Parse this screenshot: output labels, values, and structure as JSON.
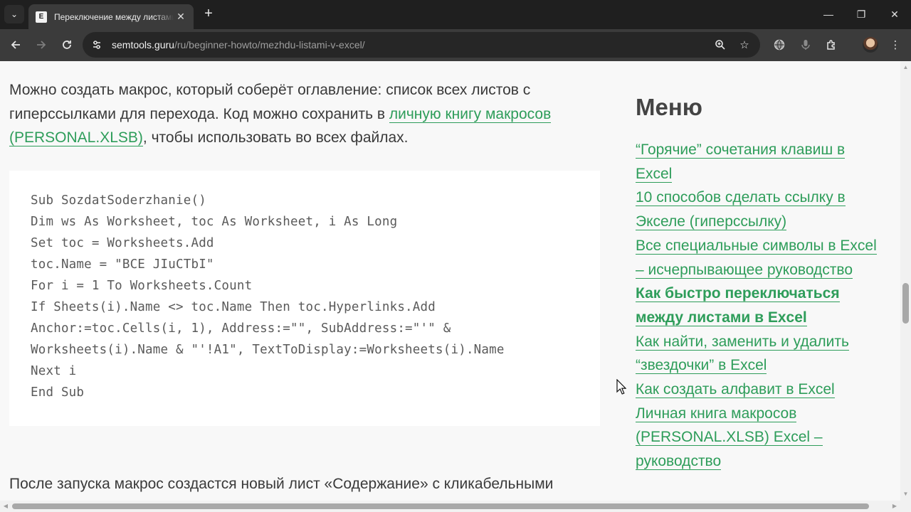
{
  "browser": {
    "tab": {
      "favicon": "E",
      "title": "Переключение между листами",
      "close": "✕"
    },
    "new_tab": "+",
    "window": {
      "minimize": "—",
      "restore": "❐",
      "close": "✕"
    },
    "url_host": "semtools.guru",
    "url_path": "/ru/beginner-howto/mezhdu-listami-v-excel/",
    "icons": [
      "tab-search-icon",
      "back-icon",
      "forward-icon",
      "reload-icon",
      "site-info-icon",
      "zoom-icon",
      "bookmark-star-icon",
      "translate-icon",
      "microphone-icon",
      "extensions-icon",
      "profile-avatar",
      "more-menu-icon"
    ]
  },
  "article": {
    "intro_before": "Можно создать макрос, который соберёт оглавление: список всех листов с гиперссылками для перехода. Код можно сохранить в ",
    "intro_link": "личную книгу макросов (PERSONAL.XLSB)",
    "intro_after": ", чтобы использовать во всех файлах.",
    "code": [
      "Sub SozdatSoderzhanie()",
      "Dim ws As Worksheet, toc As Worksheet, i As Long",
      "Set toc = Worksheets.Add",
      "toc.Name = \"ВСЕ JIuCTbI\"",
      "For i = 1 To Worksheets.Count",
      "If Sheets(i).Name <> toc.Name Then toc.Hyperlinks.Add",
      "Anchor:=toc.Cells(i, 1), Address:=\"\", SubAddress:=\"'\" &",
      "Worksheets(i).Name & \"'!A1\", TextToDisplay:=Worksheets(i).Name",
      "Next i",
      "End Sub"
    ],
    "after_text": "После запуска макрос создастся новый лист «Содержание» с кликабельными"
  },
  "sidebar": {
    "title": "Меню",
    "items": [
      {
        "label": "“Горячие” сочетания клавиш в Excel",
        "current": false
      },
      {
        "label": "10 способов сделать ссылку в Экселе (гиперссылку)",
        "current": false
      },
      {
        "label": "Все специальные символы в Excel – исчерпывающее руководство",
        "current": false
      },
      {
        "label": "Как быстро переключаться между листами в Excel",
        "current": true
      },
      {
        "label": "Как найти, заменить и удалить “звездочки” в Excel",
        "current": false
      },
      {
        "label": "Как создать алфавит в Excel",
        "current": false
      },
      {
        "label": "Личная книга макросов (PERSONAL.XLSB) Excel – руководство",
        "current": false
      }
    ]
  },
  "colors": {
    "link": "#2e9d5a",
    "text": "#3a3a3a",
    "chrome_dark": "#1f1f1f",
    "toolbar": "#3b3b3b"
  }
}
